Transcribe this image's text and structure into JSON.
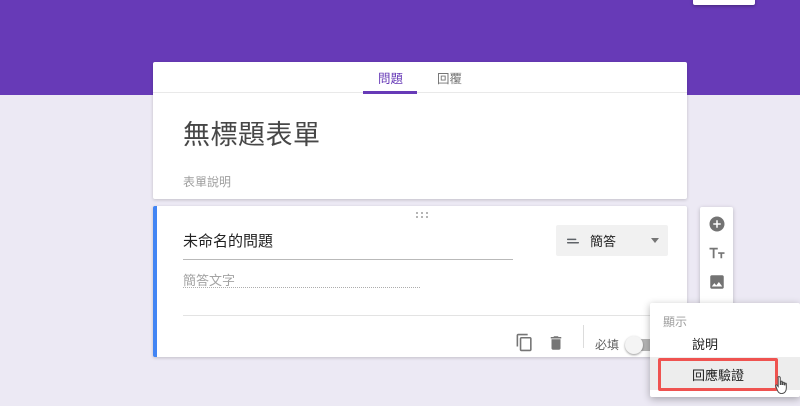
{
  "banner": {
    "color": "#673ab7",
    "send_button_remnant": "send-button-cropped"
  },
  "tabs": {
    "questions_label": "問題",
    "responses_label": "回覆",
    "active": "問題"
  },
  "form": {
    "title": "無標題表單",
    "description_placeholder": "表單說明"
  },
  "question": {
    "title": "未命名的問題",
    "answer_placeholder": "簡答文字",
    "type_label": "簡答",
    "required_label": "必填",
    "required_on": false,
    "selected": true,
    "selected_border_color": "#4285f4"
  },
  "side_toolbar": {
    "icons": [
      "add-question-icon",
      "add-title-text-icon",
      "add-image-icon"
    ]
  },
  "context_menu": {
    "header_label": "顯示",
    "items": [
      {
        "label": "說明",
        "highlighted": false
      },
      {
        "label": "回應驗證",
        "highlighted": true
      }
    ],
    "annotation_color": "#ef5350"
  }
}
